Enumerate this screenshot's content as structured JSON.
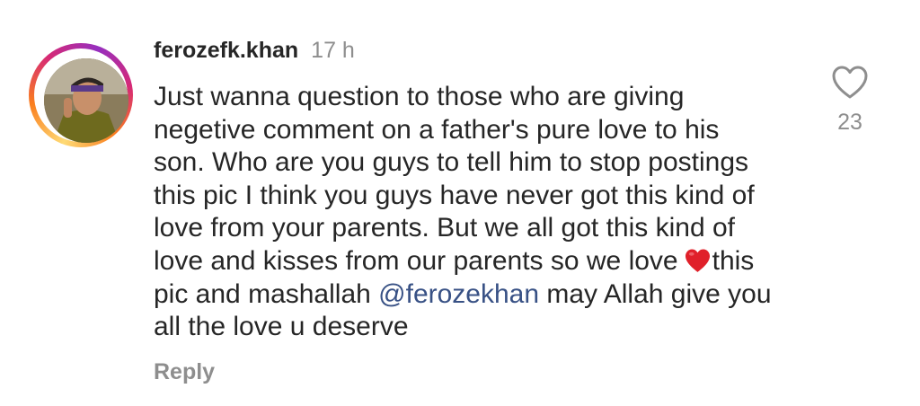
{
  "comment": {
    "username": "ferozefk.khan",
    "time": "17 h",
    "lines": [
      "Just wanna question to those who are giving",
      "negetive comment on a father's pure love to his",
      "son. Who are you guys to tell him to stop postings",
      "this pic I think you guys have never got this kind of",
      "love from your parents. But we all got this kind of"
    ],
    "line6_before": "love and kisses from our parents so we love",
    "line6_after": "this",
    "line7_before": "pic and mashallah ",
    "mention": "@ferozekhan",
    "line7_after": " may Allah give you",
    "line8": "all the love u deserve",
    "emoji_icon": "red-heart-emoji",
    "reply_label": "Reply",
    "like_icon": "heart-outline-icon",
    "like_count": "23"
  },
  "colors": {
    "text": "#262626",
    "secondary": "#8e8e8e",
    "mention": "#385185",
    "heart_emoji": "#e0202a"
  }
}
